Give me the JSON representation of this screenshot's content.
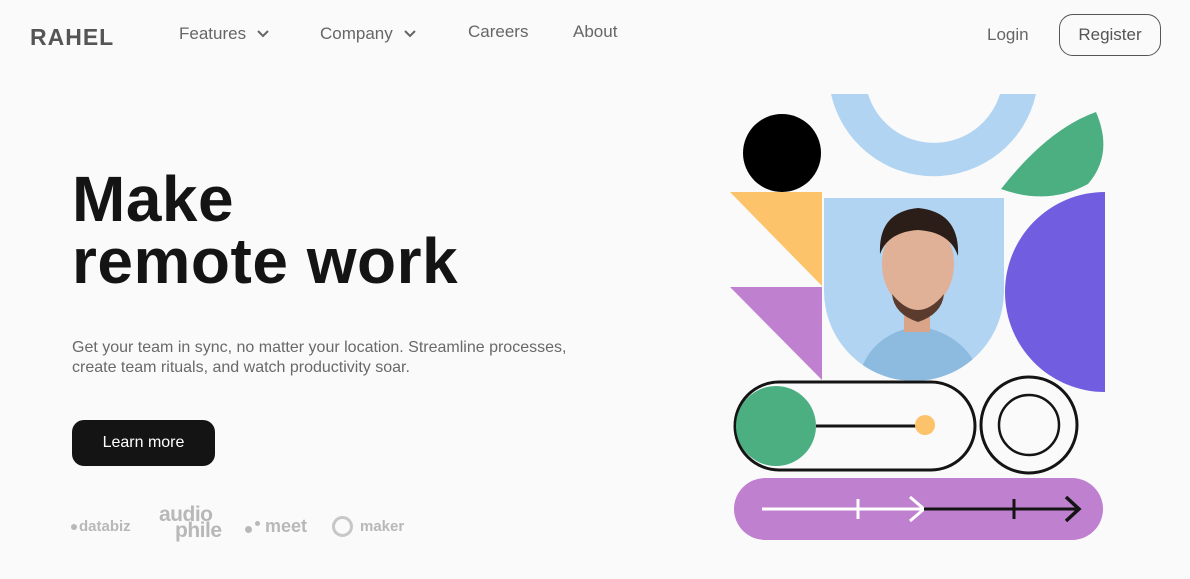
{
  "brand": {
    "name": "RAHEL"
  },
  "nav": {
    "items": [
      {
        "label": "Features",
        "has_dropdown": true
      },
      {
        "label": "Company",
        "has_dropdown": true
      },
      {
        "label": "Careers",
        "has_dropdown": false
      },
      {
        "label": "About",
        "has_dropdown": false
      }
    ],
    "login_label": "Login",
    "register_label": "Register"
  },
  "hero": {
    "title_line1": "Make",
    "title_line2": "remote work",
    "subtitle_line1": "Get your team in sync, no matter your location. Streamline processes,",
    "subtitle_line2": "create team rituals, and watch productivity soar.",
    "cta_label": "Learn more"
  },
  "clients": {
    "databiz": "databiz",
    "audiophile_line1": "audio",
    "audiophile_line2": "phile",
    "meet": "meet",
    "maker": "maker"
  },
  "colors": {
    "dark": "#141414",
    "light_blue": "#b1d4f2",
    "green": "#4caf82",
    "yellow": "#fcc36a",
    "purple": "#c080d0",
    "violet": "#705de0"
  },
  "icons": [
    "chevron-down-icon",
    "profile-photo",
    "arrow-right-icon"
  ]
}
